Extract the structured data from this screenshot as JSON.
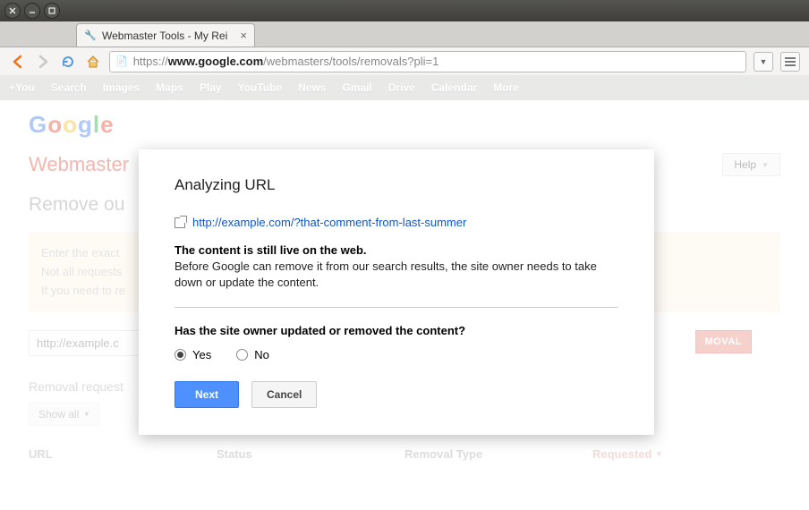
{
  "browser": {
    "tab_title": "Webmaster Tools - My Rei",
    "url_protocol": "https://",
    "url_domain": "www.google.com",
    "url_path": "/webmasters/tools/removals?pli=1"
  },
  "google_bar": [
    "+You",
    "Search",
    "Images",
    "Maps",
    "Play",
    "YouTube",
    "News",
    "Gmail",
    "Drive",
    "Calendar",
    "More"
  ],
  "page": {
    "wm_title": "Webmaster",
    "help_label": "Help",
    "remove_heading": "Remove ou",
    "yellow_lines": [
      "Enter the exact",
      "Not all requests",
      "If you need to re"
    ],
    "url_input_placeholder": "http://example.c",
    "removal_btn": "MOVAL",
    "removal_requests_label": "Removal request",
    "show_all_label": "Show all",
    "table": {
      "url": "URL",
      "status": "Status",
      "removal_type": "Removal Type",
      "requested": "Requested"
    }
  },
  "dialog": {
    "title": "Analyzing URL",
    "url": "http://example.com/?that-comment-from-last-summer",
    "strong_text": "The content is still live on the web.",
    "body_text": "Before Google can remove it from our search results, the site owner needs to take down or update the content.",
    "question": "Has the site owner updated or removed the content?",
    "option_yes": "Yes",
    "option_no": "No",
    "next_btn": "Next",
    "cancel_btn": "Cancel"
  }
}
